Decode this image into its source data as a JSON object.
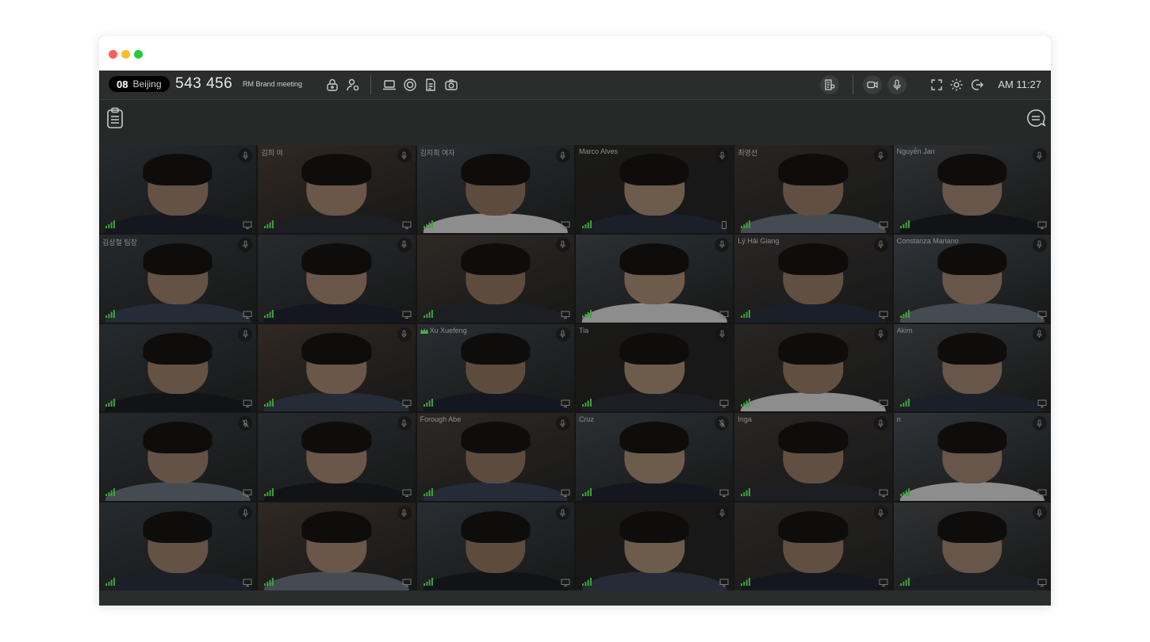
{
  "window": {
    "traffic_lights": [
      "close",
      "minimize",
      "zoom"
    ]
  },
  "toolbar": {
    "room_number": "08",
    "room_city": "Beijing",
    "meeting_id": "543 456",
    "meeting_name": "RM Brand meeting",
    "left_icons": [
      "lock-icon",
      "user-settings-icon",
      "laptop-icon",
      "record-icon",
      "document-icon",
      "camera-icon"
    ],
    "right_icons": [
      "participants-list-icon",
      "video-icon",
      "mic-icon",
      "fullscreen-icon",
      "gear-icon",
      "exit-icon"
    ],
    "time": "AM 11:27"
  },
  "subbar": {
    "left_icon": "clipboard-icon",
    "right_icon": "chat-icon"
  },
  "participants": [
    {
      "name": "",
      "device": "desktop",
      "mic": "on",
      "host": false
    },
    {
      "name": "김희 여",
      "device": "desktop",
      "mic": "on",
      "host": false
    },
    {
      "name": "김지희 여자",
      "device": "desktop",
      "mic": "on",
      "host": false
    },
    {
      "name": "Marco Alves",
      "device": "mobile",
      "mic": "on",
      "host": false
    },
    {
      "name": "최영선",
      "device": "desktop",
      "mic": "on",
      "host": false
    },
    {
      "name": "Nguyễn Jan",
      "device": "desktop",
      "mic": "on",
      "host": false
    },
    {
      "name": "김상철 팀장",
      "device": "desktop",
      "mic": "on",
      "host": false
    },
    {
      "name": "",
      "device": "desktop",
      "mic": "on",
      "host": false
    },
    {
      "name": "",
      "device": "desktop",
      "mic": "on",
      "host": false
    },
    {
      "name": "",
      "device": "desktop",
      "mic": "on",
      "host": false
    },
    {
      "name": "Lý Hải Giang",
      "device": "desktop",
      "mic": "on",
      "host": false
    },
    {
      "name": "Constanza Mariano",
      "device": "desktop",
      "mic": "on",
      "host": false
    },
    {
      "name": "",
      "device": "desktop",
      "mic": "on",
      "host": false
    },
    {
      "name": "",
      "device": "desktop",
      "mic": "on",
      "host": false
    },
    {
      "name": "Xu Xuefeng",
      "device": "desktop",
      "mic": "on",
      "host": true
    },
    {
      "name": "Tia",
      "device": "desktop",
      "mic": "on",
      "host": false
    },
    {
      "name": "",
      "device": "desktop",
      "mic": "on",
      "host": false
    },
    {
      "name": "Akim",
      "device": "desktop",
      "mic": "on",
      "host": false
    },
    {
      "name": "",
      "device": "desktop",
      "mic": "muted",
      "host": false
    },
    {
      "name": "",
      "device": "desktop",
      "mic": "on",
      "host": false
    },
    {
      "name": "Forough Abe",
      "device": "desktop",
      "mic": "on",
      "host": false
    },
    {
      "name": "Cruz",
      "device": "desktop",
      "mic": "muted",
      "host": false
    },
    {
      "name": "Inga",
      "device": "desktop",
      "mic": "on",
      "host": false
    },
    {
      "name": "n",
      "device": "desktop",
      "mic": "on",
      "host": false
    },
    {
      "name": "",
      "device": "desktop",
      "mic": "on",
      "host": false
    },
    {
      "name": "",
      "device": "desktop",
      "mic": "on",
      "host": false
    },
    {
      "name": "",
      "device": "desktop",
      "mic": "on",
      "host": false
    },
    {
      "name": "",
      "device": "desktop",
      "mic": "on",
      "host": false
    },
    {
      "name": "",
      "device": "desktop",
      "mic": "on",
      "host": false
    },
    {
      "name": "",
      "device": "desktop",
      "mic": "on",
      "host": false
    }
  ],
  "colors": {
    "accent_signal": "#3fa33a",
    "toolbar_bg": "#2b2d2c"
  }
}
